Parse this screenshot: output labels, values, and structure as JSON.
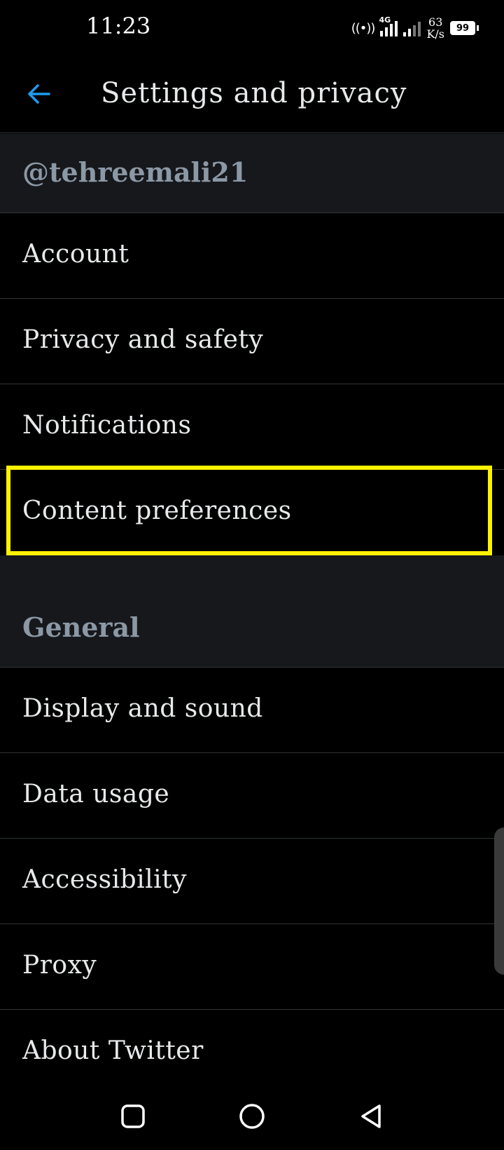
{
  "status_bar": {
    "time": "11:23",
    "network_type": "4G",
    "speed_value": "63",
    "speed_unit": "K/s",
    "battery": "99"
  },
  "header": {
    "title": "Settings and privacy",
    "back_icon": "arrow-left-icon",
    "accent_color": "#1d9bf0"
  },
  "account_section": {
    "username": "@tehreemali21",
    "items": [
      {
        "label": "Account"
      },
      {
        "label": "Privacy and safety"
      },
      {
        "label": "Notifications"
      },
      {
        "label": "Content preferences"
      }
    ]
  },
  "general_section": {
    "title": "General",
    "items": [
      {
        "label": "Display and sound"
      },
      {
        "label": "Data usage"
      },
      {
        "label": "Accessibility"
      },
      {
        "label": "Proxy"
      },
      {
        "label": "About Twitter"
      }
    ]
  },
  "highlight_color": "#fff200",
  "nav_bar": {
    "recents_icon": "square-icon",
    "home_icon": "circle-icon",
    "back_icon": "triangle-back-icon"
  }
}
